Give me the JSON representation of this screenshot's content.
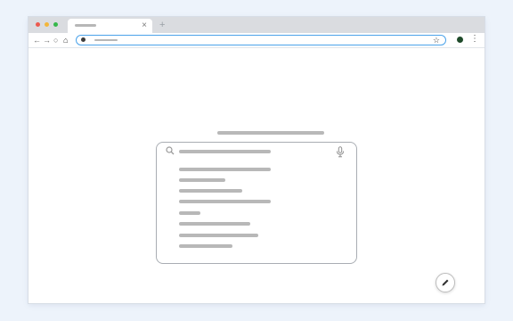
{
  "colors": {
    "traffic_close": "#ec5a4f",
    "traffic_minimize": "#f3b63a",
    "traffic_maximize": "#36b84a",
    "omnibox_border": "#4ba3ea",
    "placeholder_gray": "#b8b8b8"
  },
  "tabbar": {
    "close_glyph": "×",
    "new_tab_glyph": "+"
  },
  "toolbar": {
    "back_glyph": "←",
    "forward_glyph": "→",
    "reload_glyph": "○",
    "home_glyph": "⌂",
    "star_glyph": "☆",
    "menu_glyph": "⋮"
  },
  "icons": {
    "search": "search-icon",
    "mic": "microphone-icon",
    "edit": "pencil-icon",
    "lock": "lock-icon",
    "profile": "avatar"
  }
}
